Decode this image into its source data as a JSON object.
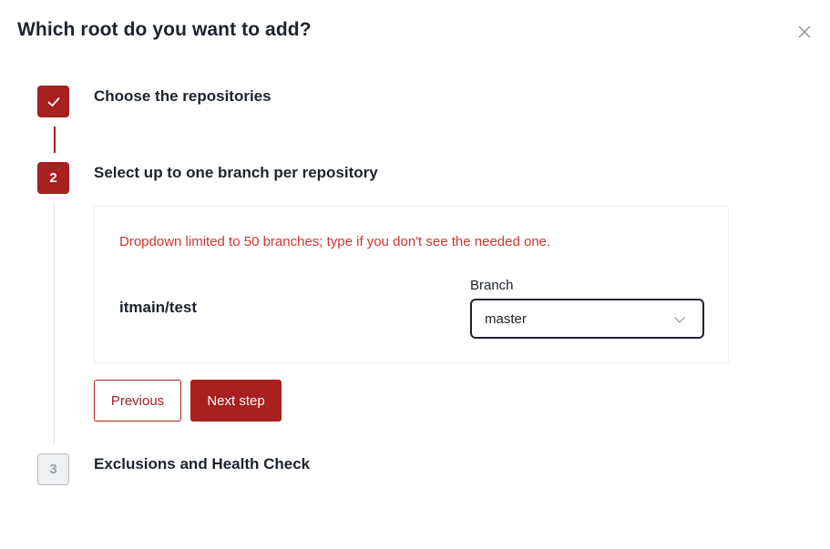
{
  "dialog": {
    "title": "Which root do you want to add?"
  },
  "steps": [
    {
      "number": "1",
      "label": "Choose the repositories",
      "state": "done"
    },
    {
      "number": "2",
      "label": "Select up to one branch per repository",
      "state": "active"
    },
    {
      "number": "3",
      "label": "Exclusions and Health Check",
      "state": "pending"
    }
  ],
  "branch_step": {
    "warning": "Dropdown limited to 50 branches; type if you don't see the needed one.",
    "repository": "itmain/test",
    "branch_label": "Branch",
    "branch_value": "master"
  },
  "buttons": {
    "previous": "Previous",
    "next": "Next step"
  },
  "colors": {
    "accent": "#a8201f",
    "warning": "#d0352f"
  },
  "icons": {
    "close": "close-icon",
    "check": "check-icon",
    "dropdown": "chevron-down-icon"
  }
}
